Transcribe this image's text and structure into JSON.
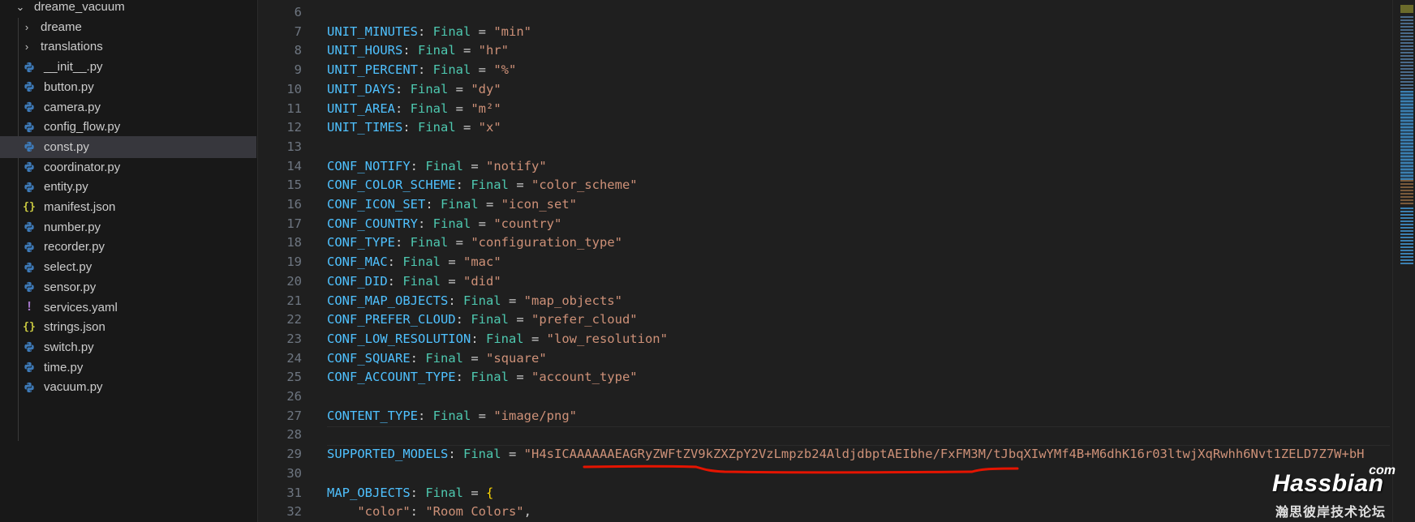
{
  "explorer": {
    "folder_name": "dreame_vacuum",
    "items": [
      {
        "label": "dreame",
        "type": "folder"
      },
      {
        "label": "translations",
        "type": "folder"
      },
      {
        "label": "__init__.py",
        "type": "py"
      },
      {
        "label": "button.py",
        "type": "py"
      },
      {
        "label": "camera.py",
        "type": "py"
      },
      {
        "label": "config_flow.py",
        "type": "py"
      },
      {
        "label": "const.py",
        "type": "py",
        "selected": true
      },
      {
        "label": "coordinator.py",
        "type": "py"
      },
      {
        "label": "entity.py",
        "type": "py"
      },
      {
        "label": "manifest.json",
        "type": "json"
      },
      {
        "label": "number.py",
        "type": "py"
      },
      {
        "label": "recorder.py",
        "type": "py"
      },
      {
        "label": "select.py",
        "type": "py"
      },
      {
        "label": "sensor.py",
        "type": "py"
      },
      {
        "label": "services.yaml",
        "type": "yaml"
      },
      {
        "label": "strings.json",
        "type": "json"
      },
      {
        "label": "switch.py",
        "type": "py"
      },
      {
        "label": "time.py",
        "type": "py"
      },
      {
        "label": "vacuum.py",
        "type": "py"
      }
    ]
  },
  "icons": {
    "folder_chevron": "chevron-down-icon",
    "subfolder_chevron": "chevron-right-icon",
    "py": "python-file-icon",
    "json": "json-file-icon",
    "yaml": "yaml-file-icon"
  },
  "editor": {
    "lines": [
      {
        "n": "6",
        "tokens": []
      },
      {
        "n": "7",
        "tokens": [
          [
            "var",
            "UNIT_MINUTES"
          ],
          [
            "plain",
            ": "
          ],
          [
            "type",
            "Final"
          ],
          [
            "plain",
            " = "
          ],
          [
            "str",
            "\"min\""
          ]
        ]
      },
      {
        "n": "8",
        "tokens": [
          [
            "var",
            "UNIT_HOURS"
          ],
          [
            "plain",
            ": "
          ],
          [
            "type",
            "Final"
          ],
          [
            "plain",
            " = "
          ],
          [
            "str",
            "\"hr\""
          ]
        ]
      },
      {
        "n": "9",
        "tokens": [
          [
            "var",
            "UNIT_PERCENT"
          ],
          [
            "plain",
            ": "
          ],
          [
            "type",
            "Final"
          ],
          [
            "plain",
            " = "
          ],
          [
            "str",
            "\"%\""
          ]
        ]
      },
      {
        "n": "10",
        "tokens": [
          [
            "var",
            "UNIT_DAYS"
          ],
          [
            "plain",
            ": "
          ],
          [
            "type",
            "Final"
          ],
          [
            "plain",
            " = "
          ],
          [
            "str",
            "\"dy\""
          ]
        ]
      },
      {
        "n": "11",
        "tokens": [
          [
            "var",
            "UNIT_AREA"
          ],
          [
            "plain",
            ": "
          ],
          [
            "type",
            "Final"
          ],
          [
            "plain",
            " = "
          ],
          [
            "str",
            "\"m²\""
          ]
        ]
      },
      {
        "n": "12",
        "tokens": [
          [
            "var",
            "UNIT_TIMES"
          ],
          [
            "plain",
            ": "
          ],
          [
            "type",
            "Final"
          ],
          [
            "plain",
            " = "
          ],
          [
            "str",
            "\"x\""
          ]
        ]
      },
      {
        "n": "13",
        "tokens": []
      },
      {
        "n": "14",
        "tokens": [
          [
            "var",
            "CONF_NOTIFY"
          ],
          [
            "plain",
            ": "
          ],
          [
            "type",
            "Final"
          ],
          [
            "plain",
            " = "
          ],
          [
            "str",
            "\"notify\""
          ]
        ]
      },
      {
        "n": "15",
        "tokens": [
          [
            "var",
            "CONF_COLOR_SCHEME"
          ],
          [
            "plain",
            ": "
          ],
          [
            "type",
            "Final"
          ],
          [
            "plain",
            " = "
          ],
          [
            "str",
            "\"color_scheme\""
          ]
        ]
      },
      {
        "n": "16",
        "tokens": [
          [
            "var",
            "CONF_ICON_SET"
          ],
          [
            "plain",
            ": "
          ],
          [
            "type",
            "Final"
          ],
          [
            "plain",
            " = "
          ],
          [
            "str",
            "\"icon_set\""
          ]
        ]
      },
      {
        "n": "17",
        "tokens": [
          [
            "var",
            "CONF_COUNTRY"
          ],
          [
            "plain",
            ": "
          ],
          [
            "type",
            "Final"
          ],
          [
            "plain",
            " = "
          ],
          [
            "str",
            "\"country\""
          ]
        ]
      },
      {
        "n": "18",
        "tokens": [
          [
            "var",
            "CONF_TYPE"
          ],
          [
            "plain",
            ": "
          ],
          [
            "type",
            "Final"
          ],
          [
            "plain",
            " = "
          ],
          [
            "str",
            "\"configuration_type\""
          ]
        ]
      },
      {
        "n": "19",
        "tokens": [
          [
            "var",
            "CONF_MAC"
          ],
          [
            "plain",
            ": "
          ],
          [
            "type",
            "Final"
          ],
          [
            "plain",
            " = "
          ],
          [
            "str",
            "\"mac\""
          ]
        ]
      },
      {
        "n": "20",
        "tokens": [
          [
            "var",
            "CONF_DID"
          ],
          [
            "plain",
            ": "
          ],
          [
            "type",
            "Final"
          ],
          [
            "plain",
            " = "
          ],
          [
            "str",
            "\"did\""
          ]
        ]
      },
      {
        "n": "21",
        "tokens": [
          [
            "var",
            "CONF_MAP_OBJECTS"
          ],
          [
            "plain",
            ": "
          ],
          [
            "type",
            "Final"
          ],
          [
            "plain",
            " = "
          ],
          [
            "str",
            "\"map_objects\""
          ]
        ]
      },
      {
        "n": "22",
        "tokens": [
          [
            "var",
            "CONF_PREFER_CLOUD"
          ],
          [
            "plain",
            ": "
          ],
          [
            "type",
            "Final"
          ],
          [
            "plain",
            " = "
          ],
          [
            "str",
            "\"prefer_cloud\""
          ]
        ]
      },
      {
        "n": "23",
        "tokens": [
          [
            "var",
            "CONF_LOW_RESOLUTION"
          ],
          [
            "plain",
            ": "
          ],
          [
            "type",
            "Final"
          ],
          [
            "plain",
            " = "
          ],
          [
            "str",
            "\"low_resolution\""
          ]
        ]
      },
      {
        "n": "24",
        "tokens": [
          [
            "var",
            "CONF_SQUARE"
          ],
          [
            "plain",
            ": "
          ],
          [
            "type",
            "Final"
          ],
          [
            "plain",
            " = "
          ],
          [
            "str",
            "\"square\""
          ]
        ]
      },
      {
        "n": "25",
        "tokens": [
          [
            "var",
            "CONF_ACCOUNT_TYPE"
          ],
          [
            "plain",
            ": "
          ],
          [
            "type",
            "Final"
          ],
          [
            "plain",
            " = "
          ],
          [
            "str",
            "\"account_type\""
          ]
        ]
      },
      {
        "n": "26",
        "tokens": []
      },
      {
        "n": "27",
        "tokens": [
          [
            "var",
            "CONTENT_TYPE"
          ],
          [
            "plain",
            ": "
          ],
          [
            "type",
            "Final"
          ],
          [
            "plain",
            " = "
          ],
          [
            "str",
            "\"image/png\""
          ]
        ]
      },
      {
        "n": "28",
        "tokens": []
      },
      {
        "n": "29",
        "tokens": [
          [
            "var",
            "SUPPORTED_MODELS"
          ],
          [
            "plain",
            ": "
          ],
          [
            "type",
            "Final"
          ],
          [
            "plain",
            " = "
          ],
          [
            "str",
            "\"H4sICAAAAAAEAGRyZWFtZV9kZXZpY2VzLmpzb24AldjdbptAEIbhe/FxFM3M/tJbqXIwYMf4B+M6dhK16r03ltwjXqRwhh6Nvt1ZELD7Z7W+bH"
          ]
        ]
      },
      {
        "n": "30",
        "tokens": []
      },
      {
        "n": "31",
        "tokens": [
          [
            "var",
            "MAP_OBJECTS"
          ],
          [
            "plain",
            ": "
          ],
          [
            "type",
            "Final"
          ],
          [
            "plain",
            " = "
          ],
          [
            "brace",
            "{"
          ]
        ]
      },
      {
        "n": "32",
        "tokens": [
          [
            "plain",
            "    "
          ],
          [
            "key",
            "\"color\""
          ],
          [
            "plain",
            ": "
          ],
          [
            "str",
            "\"Room Colors\""
          ],
          [
            "plain",
            ","
          ]
        ]
      }
    ]
  },
  "watermark": {
    "brand": "Hassbian",
    "suffix": "com",
    "subtitle": "瀚思彼岸技术论坛"
  },
  "colors": {
    "background": "#1f1f1f",
    "sidebar": "#181818",
    "variable": "#4fc1ff",
    "type": "#4ec9b0",
    "string": "#ce9178",
    "annotation": "#e51400"
  }
}
